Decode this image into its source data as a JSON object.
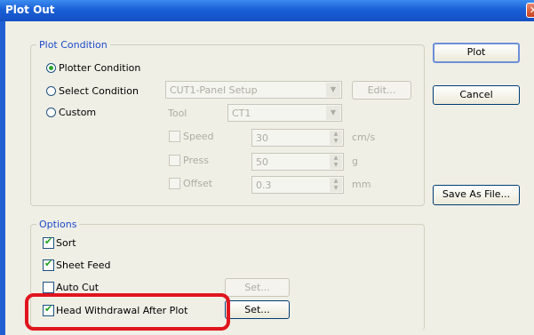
{
  "window": {
    "title": "Plot Out",
    "close_glyph": "✕"
  },
  "plot_condition": {
    "legend": "Plot Condition",
    "options": [
      {
        "label": "Plotter Condition",
        "selected": true
      },
      {
        "label": "Select Condition",
        "selected": false
      },
      {
        "label": "Custom",
        "selected": false
      }
    ],
    "select_value": "CUT1-Panel Setup",
    "edit_label": "Edit...",
    "tool_label": "Tool",
    "tool_value": "CT1",
    "speed_label": "Speed",
    "speed_value": "30",
    "speed_unit": "cm/s",
    "press_label": "Press",
    "press_value": "50",
    "press_unit": "g",
    "offset_label": "Offset",
    "offset_value": "0.3",
    "offset_unit": "mm"
  },
  "options": {
    "legend": "Options",
    "items": [
      {
        "label": "Sort",
        "checked": true
      },
      {
        "label": "Sheet Feed",
        "checked": true
      },
      {
        "label": "Auto Cut",
        "checked": false
      },
      {
        "label": "Head Withdrawal After Plot",
        "checked": true
      }
    ],
    "set_label_1": "Set...",
    "set_label_2": "Set..."
  },
  "buttons": {
    "plot": "Plot",
    "cancel": "Cancel",
    "save_as_file": "Save As File..."
  },
  "colors": {
    "highlight": "#e0151e",
    "legend_text": "#1c4bc9",
    "check_mark": "#21a121",
    "title_bar": "#1a5fd6"
  }
}
